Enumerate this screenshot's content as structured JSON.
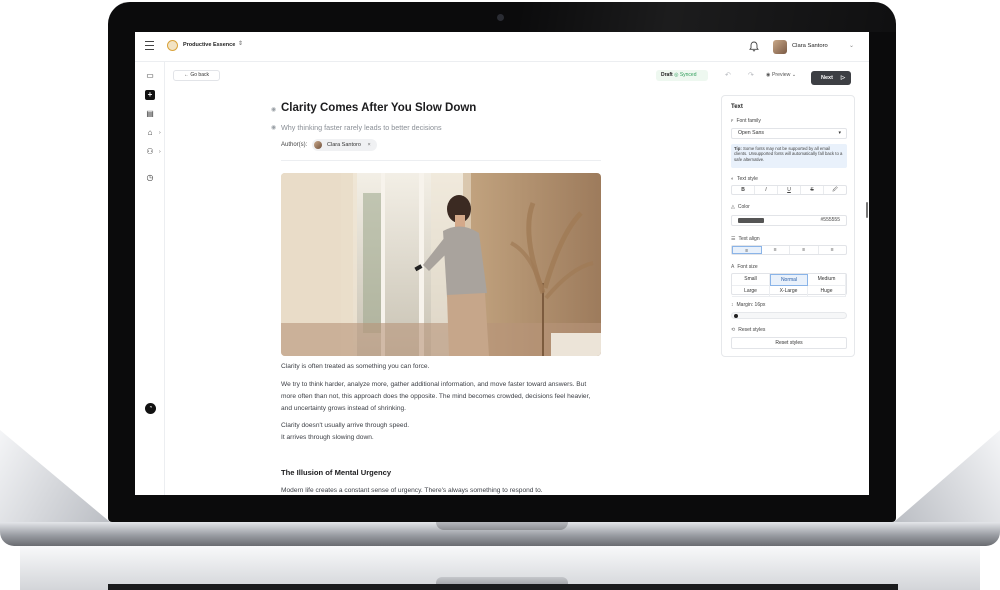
{
  "app": {
    "workspace_name": "Productive Essence",
    "user_name": "Clara Santoro"
  },
  "toolbar": {
    "go_back_label": "← Go back",
    "draft_label": "Draft",
    "synced_label": "◎ Synced",
    "preview_label": "Preview",
    "next_label": "Next"
  },
  "article": {
    "title": "Clarity Comes After You Slow Down",
    "subtitle": "Why thinking faster rarely leads to better decisions",
    "authors_label": "Author(s):",
    "author_chip": "Clara Santoro",
    "paragraphs": [
      "Clarity is often treated as something you can force.",
      "We try to think harder, analyze more, gather additional information, and move faster toward answers. But more often than not, this approach does the opposite. The mind becomes crowded, decisions feel heavier, and uncertainty grows instead of shrinking.",
      "Clarity doesn't usually arrive through speed.",
      "It arrives through slowing down."
    ],
    "section_heading": "The Illusion of Mental Urgency",
    "section_intro": "Modern life creates a constant sense of urgency. There's always something to respond to."
  },
  "panel": {
    "title": "Text",
    "font_family_label": "Font family",
    "font_family_value": "Open Sans",
    "tip_bold": "Tip:",
    "tip_text": "Some fonts may not be supported by all email clients. Unsupported fonts will automatically fall back to a safe alternative.",
    "text_style_label": "Text style",
    "text_style_options": [
      "B",
      "I",
      "U",
      "S",
      "🖉"
    ],
    "color_label": "Color",
    "color_value": "#555555",
    "text_align_label": "Text align",
    "text_align_options": [
      "≡",
      "≡",
      "≡",
      "≡"
    ],
    "font_size_label": "Font size",
    "font_size_options": [
      "Small",
      "Normal",
      "Medium",
      "Large",
      "X-Large",
      "Huge"
    ],
    "font_size_selected": "Normal",
    "margin_label": "Margin: 16px",
    "reset_label": "Reset styles",
    "reset_button": "Reset styles"
  }
}
